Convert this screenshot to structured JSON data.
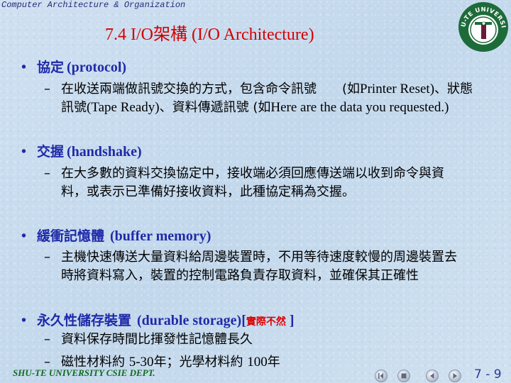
{
  "header": {
    "course": "Computer Architecture & Organization",
    "title": "7.4 I/O架構 (I/O Architecture)",
    "logo_text": "SHU-TE UNIVERSITY",
    "logo_letter": "T"
  },
  "colors": {
    "title": "#d40000",
    "bullet": "#1f2aa8",
    "emphasis": "#e00000",
    "footer": "#0d6b1e",
    "logo_green": "#1e6b3a",
    "logo_letter": "#6b1a3a"
  },
  "sections": [
    {
      "bullet_zh": "協定",
      "bullet_en": "(protocol)",
      "items": [
        {
          "text_zh": "在收送兩端做訊號交換的方式，包含命令訊號　　(如",
          "text_en_1": "Printer Reset)",
          "text_zh_2": "、狀態訊號",
          "text_en_2": "(Tape Ready)",
          "text_zh_3": "、資料傳遞訊號 (如",
          "text_en_3": "Here are the data you requested.)"
        }
      ]
    },
    {
      "bullet_zh": "交握",
      "bullet_en": "(handshake)",
      "items": [
        {
          "text": "在大多數的資料交換協定中，接收端必須回應傳送端以收到命令與資料，或表示已準備好接收資料，此種協定稱為交握。"
        }
      ]
    },
    {
      "bullet_zh": "緩衝記憶體",
      "bullet_en": "(buffer memory)",
      "items": [
        {
          "text": "主機快速傳送大量資料給周邊裝置時，不用等待速度較慢的周邊裝置去時將資料寫入，裝置的控制電路負責存取資料，並確保其正確性"
        }
      ]
    },
    {
      "bullet_zh": "永久性儲存裝置",
      "bullet_en": "(durable storage)[",
      "bullet_note": "實際不然",
      "bullet_close": " ]",
      "items": [
        {
          "text": "資料保存時間比揮發性記憶體長久"
        },
        {
          "text_zh": "磁性材料約 ",
          "text_en": "5-30",
          "text_zh_2": "年；光學材料約 ",
          "text_en_2": "100",
          "text_zh_3": "年"
        }
      ]
    }
  ],
  "footer": {
    "dept": "SHU-TE UNIVERSITY  CSIE DEPT.",
    "page": "7 - 9",
    "nav": [
      {
        "name": "first-slide",
        "icon": "skip-back-icon"
      },
      {
        "name": "end-show",
        "icon": "stop-icon"
      },
      {
        "name": "previous-slide",
        "icon": "arrow-left-icon"
      },
      {
        "name": "next-slide",
        "icon": "arrow-right-icon"
      }
    ]
  },
  "dash": "–",
  "dot": "•"
}
